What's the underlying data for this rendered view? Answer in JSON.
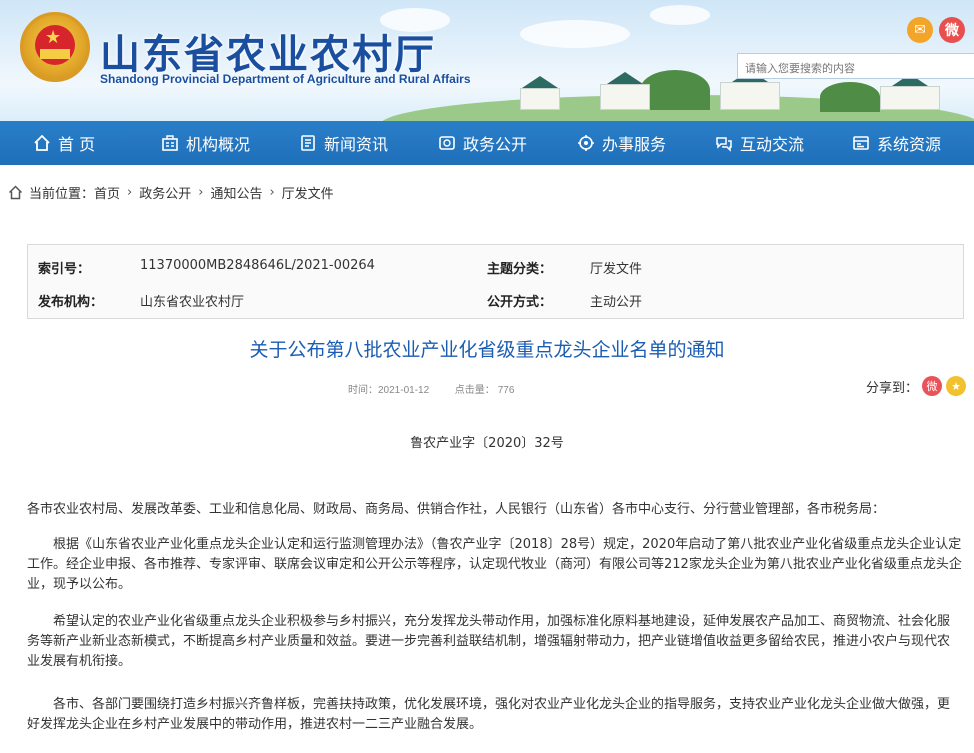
{
  "header": {
    "title": "山东省农业农村厅",
    "subtitle": "Shandong Provincial Department of Agriculture and Rural Affairs",
    "search_placeholder": "请输入您要搜索的内容",
    "icons": [
      "mail-icon",
      "weibo-icon"
    ]
  },
  "nav": {
    "items": [
      {
        "label": "首 页",
        "icon": "home-icon"
      },
      {
        "label": "机构概况",
        "icon": "org-icon"
      },
      {
        "label": "新闻资讯",
        "icon": "news-icon"
      },
      {
        "label": "政务公开",
        "icon": "gov-icon"
      },
      {
        "label": "办事服务",
        "icon": "service-icon"
      },
      {
        "label": "互动交流",
        "icon": "interact-icon"
      },
      {
        "label": "系统资源",
        "icon": "system-icon"
      }
    ]
  },
  "breadcrumb": {
    "prefix": "当前位置：",
    "items": [
      "首页",
      "政务公开",
      "通知公告",
      "厅发文件"
    ],
    "separator": "›"
  },
  "info": {
    "index_label": "索引号：",
    "index_value": "11370000MB2848646L/2021-00264",
    "topic_label": "主题分类：",
    "topic_value": "厅发文件",
    "issuer_label": "发布机构：",
    "issuer_value": "山东省农业农村厅",
    "mode_label": "公开方式：",
    "mode_value": "主动公开"
  },
  "article": {
    "title": "关于公布第八批农业产业化省级重点龙头企业名单的通知",
    "time_label": "时间：",
    "time_value": "2021-01-12",
    "hits_label": "点击量：",
    "hits_value": "776",
    "share_label": "分享到：",
    "doc_number": "鲁农产业字〔2020〕32号",
    "salutation": "各市农业农村局、发展改革委、工业和信息化局、财政局、商务局、供销合作社，人民银行（山东省）各市中心支行、分行营业管理部，各市税务局：",
    "paragraphs": [
      "根据《山东省农业产业化重点龙头企业认定和运行监测管理办法》（鲁农产业字〔2018〕28号）规定，2020年启动了第八批农业产业化省级重点龙头企业认定工作。经企业申报、各市推荐、专家评审、联席会议审定和公开公示等程序，认定现代牧业（商河）有限公司等212家龙头企业为第八批农业产业化省级重点龙头企业，现予以公布。",
      "希望认定的农业产业化省级重点龙头企业积极参与乡村振兴，充分发挥龙头带动作用，加强标准化原料基地建设，延伸发展农产品加工、商贸物流、社会化服务等新产业新业态新模式，不断提高乡村产业质量和效益。要进一步完善利益联结机制，增强辐射带动力，把产业链增值收益更多留给农民，推进小农户与现代农业发展有机衔接。",
      "各市、各部门要围绕打造乡村振兴齐鲁样板，完善扶持政策，优化发展环境，强化对农业产业化龙头企业的指导服务，支持农业产业化龙头企业做大做强，更好发挥龙头企业在乡村产业发展中的带动作用，推进农村一二三产业融合发展。"
    ]
  }
}
